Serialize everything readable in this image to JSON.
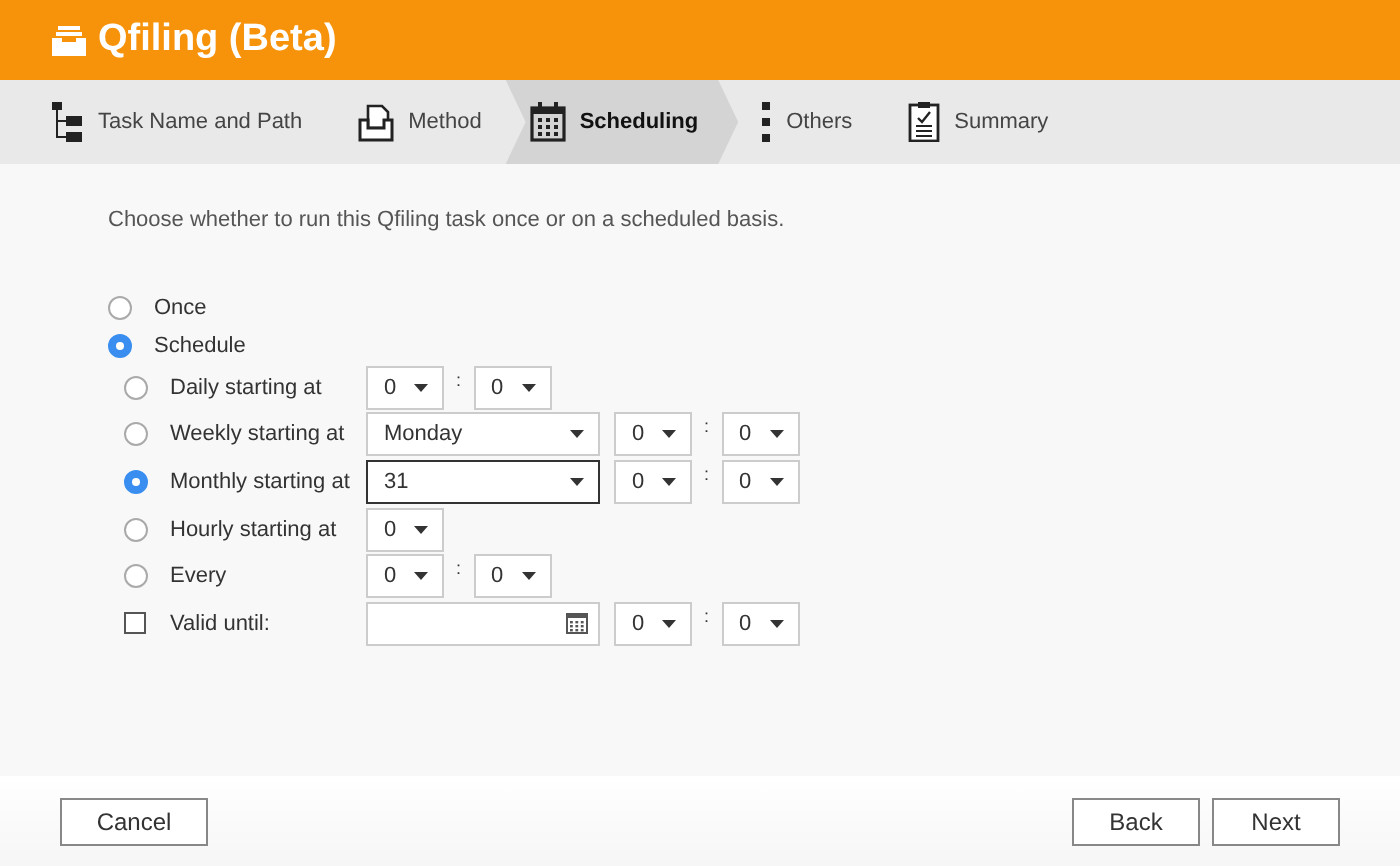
{
  "window": {
    "title": "Qfiling (Beta)"
  },
  "steps": [
    {
      "label": "Task Name and Path",
      "kind": "tree",
      "selected": false
    },
    {
      "label": "Method",
      "kind": "tray",
      "selected": false
    },
    {
      "label": "Scheduling",
      "kind": "calendar",
      "selected": true
    },
    {
      "label": "Others",
      "kind": "dots",
      "selected": false
    },
    {
      "label": "Summary",
      "kind": "clipboard",
      "selected": false
    }
  ],
  "intro": "Choose whether to run this Qfiling task once or on a scheduled basis.",
  "modes": [
    {
      "label": "Once",
      "selected": false
    },
    {
      "label": "Schedule",
      "selected": true
    }
  ],
  "schedule": [
    {
      "kind": "radio",
      "label": "Daily starting at",
      "selected": false,
      "controls": [
        {
          "kind": "time",
          "value": "0"
        },
        {
          "kind": "colon",
          "text": ":"
        },
        {
          "kind": "time",
          "value": "0"
        }
      ]
    },
    {
      "kind": "radio",
      "label": "Weekly starting at",
      "selected": false,
      "controls": [
        {
          "kind": "day",
          "value": "Monday",
          "focused": false
        },
        {
          "kind": "time",
          "value": "0"
        },
        {
          "kind": "colon",
          "text": ":"
        },
        {
          "kind": "time",
          "value": "0"
        }
      ]
    },
    {
      "kind": "radio",
      "label": "Monthly starting at",
      "selected": true,
      "controls": [
        {
          "kind": "day",
          "value": "31",
          "focused": true
        },
        {
          "kind": "time",
          "value": "0"
        },
        {
          "kind": "colon",
          "text": ":"
        },
        {
          "kind": "time",
          "value": "0"
        }
      ]
    },
    {
      "kind": "radio",
      "label": "Hourly starting at",
      "selected": false,
      "controls": [
        {
          "kind": "time",
          "value": "0"
        }
      ]
    },
    {
      "kind": "radio",
      "label": "Every",
      "selected": false,
      "controls": [
        {
          "kind": "time",
          "value": "0"
        },
        {
          "kind": "colon",
          "text": ":"
        },
        {
          "kind": "time",
          "value": "0"
        }
      ]
    },
    {
      "kind": "checkbox",
      "label": "Valid until:",
      "checked": false,
      "controls": [
        {
          "kind": "date"
        },
        {
          "kind": "time",
          "value": "0"
        },
        {
          "kind": "colon",
          "text": ":"
        },
        {
          "kind": "time",
          "value": "0"
        }
      ]
    }
  ],
  "buttons": {
    "left": [
      "Cancel"
    ],
    "right": [
      "Back",
      "Next"
    ]
  }
}
